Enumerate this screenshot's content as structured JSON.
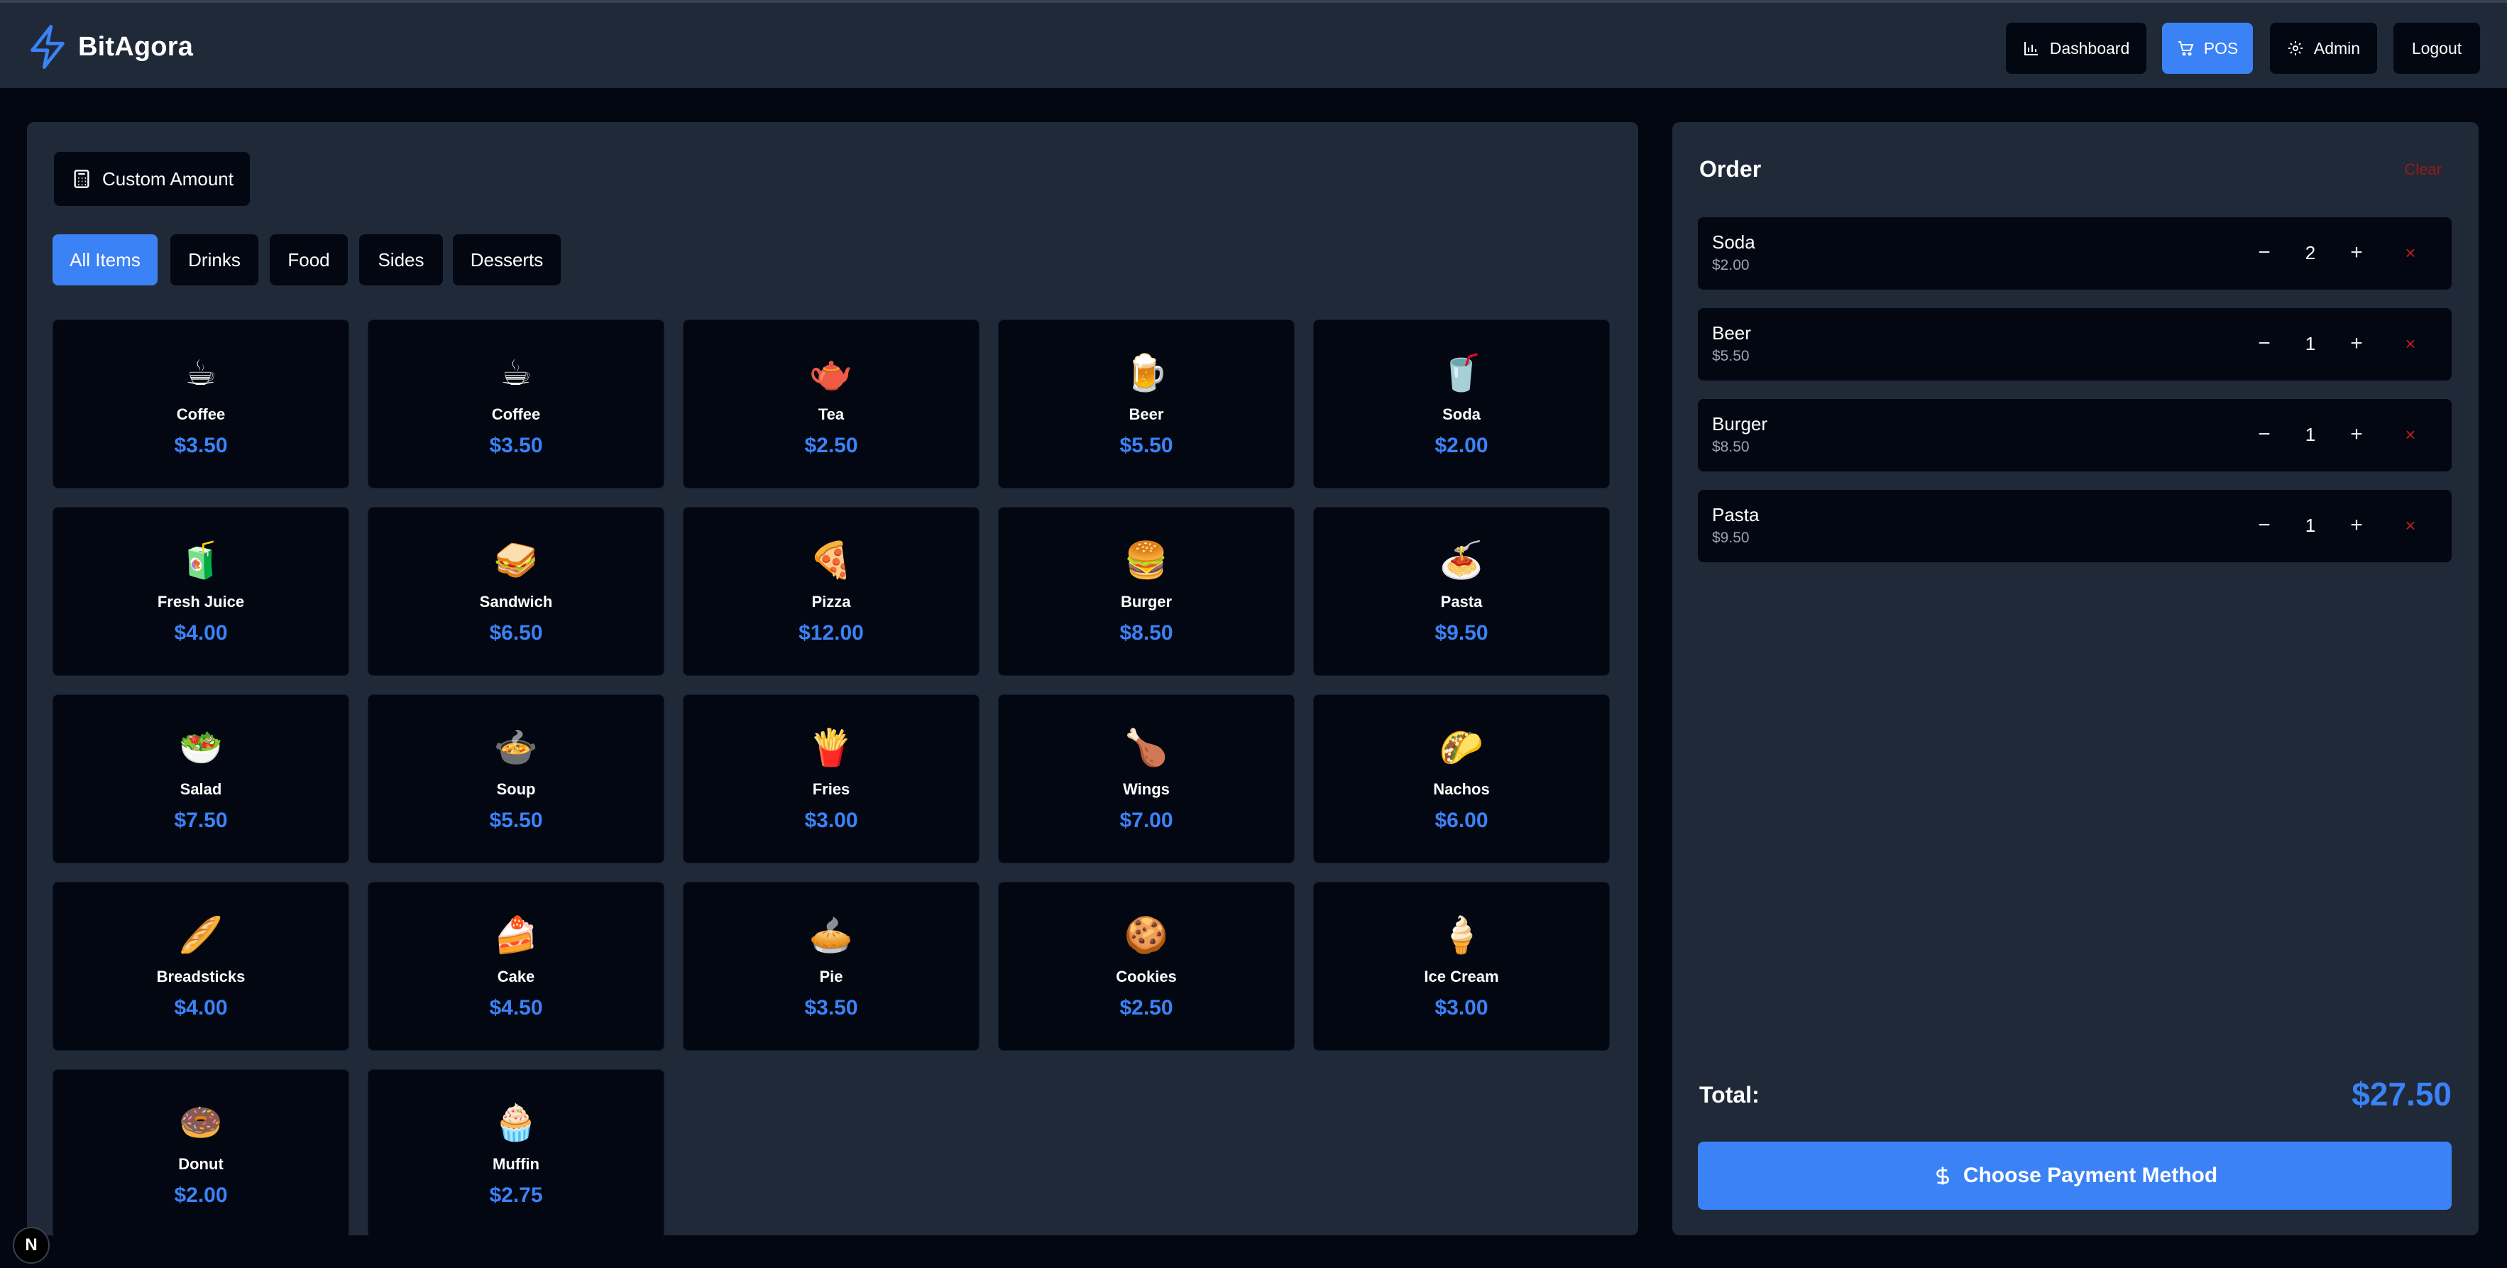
{
  "header": {
    "brand": "BitAgora",
    "nav": [
      {
        "label": "Dashboard",
        "icon": "bar-chart-icon"
      },
      {
        "label": "POS",
        "icon": "cart-icon",
        "active": true
      },
      {
        "label": "Admin",
        "icon": "gear-icon"
      },
      {
        "label": "Logout"
      }
    ]
  },
  "toolbar": {
    "custom_amount_label": "Custom Amount",
    "custom_amount_icon": "calculator-icon"
  },
  "categories": [
    {
      "label": "All Items",
      "active": true
    },
    {
      "label": "Drinks"
    },
    {
      "label": "Food"
    },
    {
      "label": "Sides"
    },
    {
      "label": "Desserts"
    }
  ],
  "products": [
    {
      "emoji": "☕",
      "name": "Coffee",
      "price": "$3.50"
    },
    {
      "emoji": "☕",
      "name": "Coffee",
      "price": "$3.50"
    },
    {
      "emoji": "🫖",
      "name": "Tea",
      "price": "$2.50"
    },
    {
      "emoji": "🍺",
      "name": "Beer",
      "price": "$5.50"
    },
    {
      "emoji": "🥤",
      "name": "Soda",
      "price": "$2.00"
    },
    {
      "emoji": "🧃",
      "name": "Fresh Juice",
      "price": "$4.00"
    },
    {
      "emoji": "🥪",
      "name": "Sandwich",
      "price": "$6.50"
    },
    {
      "emoji": "🍕",
      "name": "Pizza",
      "price": "$12.00"
    },
    {
      "emoji": "🍔",
      "name": "Burger",
      "price": "$8.50"
    },
    {
      "emoji": "🍝",
      "name": "Pasta",
      "price": "$9.50"
    },
    {
      "emoji": "🥗",
      "name": "Salad",
      "price": "$7.50"
    },
    {
      "emoji": "🍲",
      "name": "Soup",
      "price": "$5.50"
    },
    {
      "emoji": "🍟",
      "name": "Fries",
      "price": "$3.00"
    },
    {
      "emoji": "🍗",
      "name": "Wings",
      "price": "$7.00"
    },
    {
      "emoji": "🌮",
      "name": "Nachos",
      "price": "$6.00"
    },
    {
      "emoji": "🥖",
      "name": "Breadsticks",
      "price": "$4.00"
    },
    {
      "emoji": "🍰",
      "name": "Cake",
      "price": "$4.50"
    },
    {
      "emoji": "🥧",
      "name": "Pie",
      "price": "$3.50"
    },
    {
      "emoji": "🍪",
      "name": "Cookies",
      "price": "$2.50"
    },
    {
      "emoji": "🍦",
      "name": "Ice Cream",
      "price": "$3.00"
    },
    {
      "emoji": "🍩",
      "name": "Donut",
      "price": "$2.00"
    },
    {
      "emoji": "🧁",
      "name": "Muffin",
      "price": "$2.75"
    }
  ],
  "order": {
    "title": "Order",
    "clear_label": "Clear",
    "items": [
      {
        "name": "Soda",
        "price": "$2.00",
        "qty": "2"
      },
      {
        "name": "Beer",
        "price": "$5.50",
        "qty": "1"
      },
      {
        "name": "Burger",
        "price": "$8.50",
        "qty": "1"
      },
      {
        "name": "Pasta",
        "price": "$9.50",
        "qty": "1"
      }
    ],
    "minus_symbol": "−",
    "plus_symbol": "+",
    "remove_symbol": "×",
    "total_label": "Total:",
    "total_value": "$27.50",
    "pay_label": "Choose Payment Method",
    "pay_icon": "dollar-icon"
  },
  "badge": {
    "letter": "N"
  },
  "colors": {
    "accent": "#3b82f6",
    "panel": "#1f2937",
    "card": "#030712",
    "danger": "#b91c1c"
  }
}
